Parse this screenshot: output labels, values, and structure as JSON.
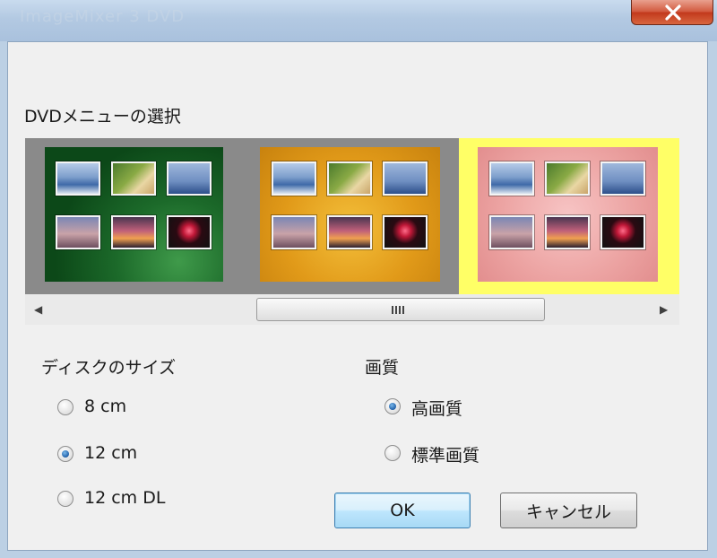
{
  "window": {
    "title": "ImageMixer 3 DVD",
    "close_symbol": "close-x"
  },
  "menu_select": {
    "label": "DVDメニューの選択",
    "templates": [
      {
        "theme": "green",
        "selected": false
      },
      {
        "theme": "orange",
        "selected": false
      },
      {
        "theme": "pink",
        "selected": true
      }
    ],
    "selected_color": "#ffff66"
  },
  "scrollbar": {
    "left_arrow": "◀",
    "right_arrow": "▶"
  },
  "disc_size": {
    "label": "ディスクのサイズ",
    "options": [
      {
        "label": "8 cm",
        "checked": false
      },
      {
        "label": "12 cm",
        "checked": true
      },
      {
        "label": "12 cm DL",
        "checked": false
      }
    ]
  },
  "quality": {
    "label": "画質",
    "options": [
      {
        "label": "高画質",
        "checked": true
      },
      {
        "label": "標準画質",
        "checked": false
      }
    ]
  },
  "buttons": {
    "ok": "OK",
    "cancel": "キャンセル"
  },
  "colors": {
    "accent": "#1f5fa8",
    "close_button": "#c2391c"
  }
}
